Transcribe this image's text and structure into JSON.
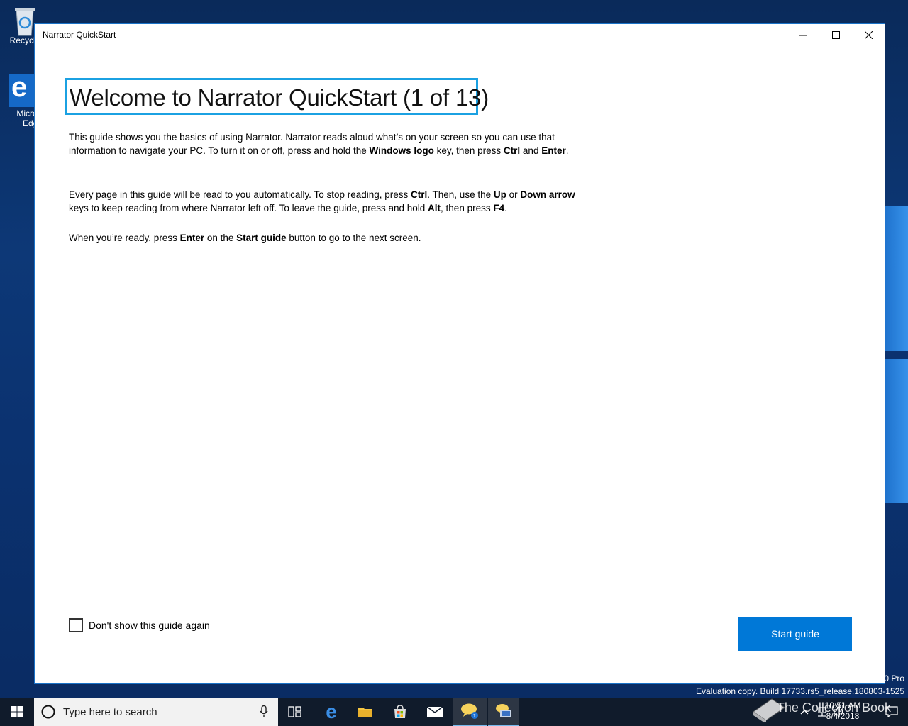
{
  "desktop": {
    "recycle_label": "Recycle",
    "edge_label_1": "Micros",
    "edge_label_2": "Edge",
    "watermark_line1": "0 Pro",
    "watermark_line2": "Evaluation copy. Build 17733.rs5_release.180803-1525"
  },
  "window": {
    "title": "Narrator QuickStart",
    "heading": "Welcome to Narrator QuickStart (1 of 13)",
    "para1": {
      "t1": "This guide shows you the basics of using Narrator. Narrator reads aloud what’s on your screen so you can use that information to navigate your PC. To turn it on or off, press and hold the ",
      "b1": "Windows logo",
      "t2": " key, then press ",
      "b2": "Ctrl",
      "t3": " and ",
      "b3": "Enter",
      "t4": "."
    },
    "para2": {
      "t1": "Every page in this guide will be read to you automatically. To stop reading, press ",
      "b1": "Ctrl",
      "t2": ". Then, use the ",
      "b2": "Up",
      "t3": " or ",
      "b3": "Down arrow",
      "t4": " keys to keep reading from where Narrator left off. To leave the guide, press and hold ",
      "b4": "Alt",
      "t5": ", then press ",
      "b5": "F4",
      "t6": "."
    },
    "para3": {
      "t1": "When you’re ready, press ",
      "b1": "Enter",
      "t2": " on the ",
      "b2": "Start guide",
      "t3": " button to go to the next screen."
    },
    "checkbox_label": "Don't show this guide again",
    "checkbox_checked": false,
    "start_button": "Start guide"
  },
  "taskbar": {
    "search_placeholder": "Type here to search",
    "time": "10:51 AM",
    "date": "8/4/2018",
    "collection_text": "The Collection Book"
  },
  "colors": {
    "accent": "#0078d7",
    "focus": "#1ba1e2",
    "taskbar": "#101b2b"
  }
}
